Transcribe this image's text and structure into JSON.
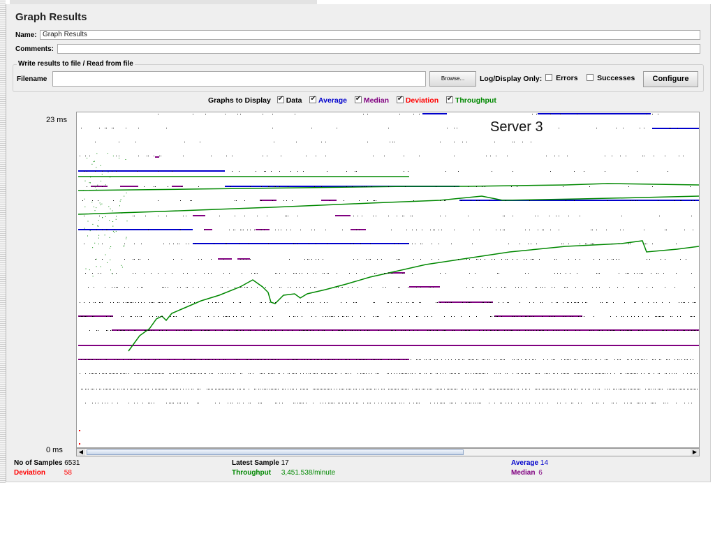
{
  "window": {
    "title": "Graph Results"
  },
  "name_field": {
    "label": "Name:",
    "value": "Graph Results"
  },
  "comments_field": {
    "label": "Comments:",
    "value": ""
  },
  "file_section": {
    "legend": "Write results to file / Read from file",
    "filename_label": "Filename",
    "filename_value": "",
    "browse_label": "Browse...",
    "log_display_label": "Log/Display Only:",
    "errors_label": "Errors",
    "errors_checked": false,
    "successes_label": "Successes",
    "successes_checked": false,
    "configure_label": "Configure"
  },
  "graphs_to_display": {
    "label": "Graphs to Display",
    "options": [
      {
        "label": "Data",
        "checked": true,
        "color": "#000000"
      },
      {
        "label": "Average",
        "checked": true,
        "color": "#0000cc"
      },
      {
        "label": "Median",
        "checked": true,
        "color": "#800080"
      },
      {
        "label": "Deviation",
        "checked": true,
        "color": "#ff0000"
      },
      {
        "label": "Throughput",
        "checked": true,
        "color": "#008800"
      }
    ]
  },
  "graph": {
    "y_max_label": "23 ms",
    "y_min_label": "0 ms",
    "overlay_label": "Server 3"
  },
  "stats": {
    "samples_label": "No of Samples",
    "samples_value": "6531",
    "deviation_label": "Deviation",
    "deviation_value": "58",
    "latest_label": "Latest Sample",
    "latest_value": "17",
    "throughput_label": "Throughput",
    "throughput_value": "3,451.538/minute",
    "average_label": "Average",
    "average_value": "14",
    "median_label": "Median",
    "median_value": "6"
  },
  "colors": {
    "data": "#000000",
    "average": "#0000cc",
    "median": "#800080",
    "deviation": "#ff0000",
    "throughput": "#008800"
  }
}
